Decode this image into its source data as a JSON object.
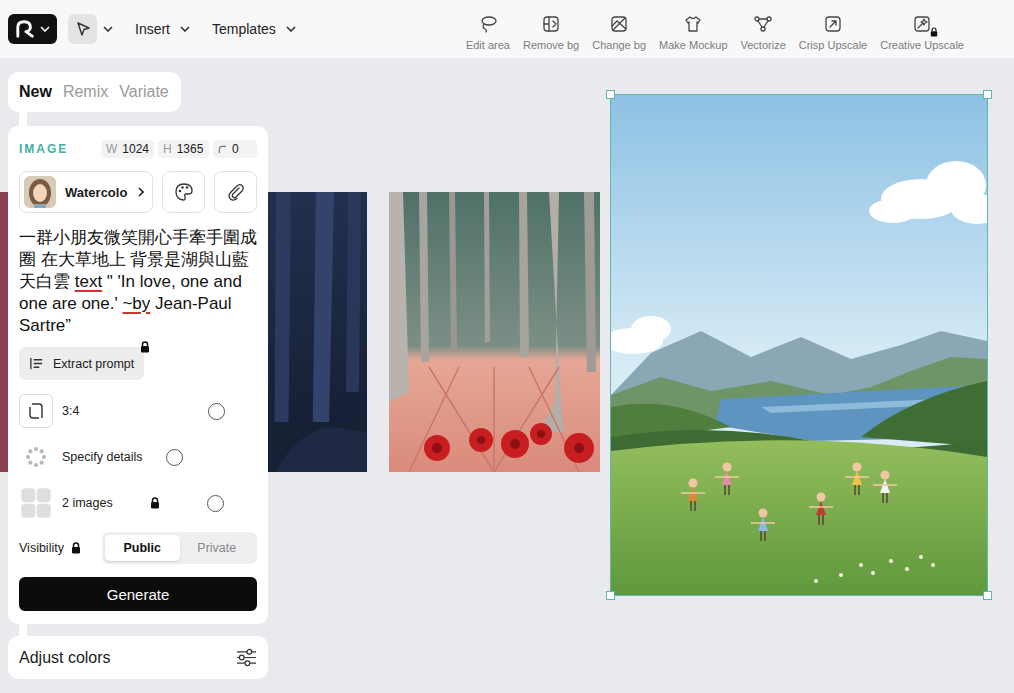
{
  "menus": [
    {
      "label": "Insert"
    },
    {
      "label": "Templates"
    }
  ],
  "tools": [
    {
      "label": "Edit area",
      "locked": false
    },
    {
      "label": "Remove bg",
      "locked": false
    },
    {
      "label": "Change bg",
      "locked": false
    },
    {
      "label": "Make Mockup",
      "locked": false
    },
    {
      "label": "Vectorize",
      "locked": false
    },
    {
      "label": "Crisp Upscale",
      "locked": false
    },
    {
      "label": "Creative Upscale",
      "locked": true
    }
  ],
  "mode_tabs": [
    {
      "label": "New",
      "selected": true
    },
    {
      "label": "Remix",
      "selected": false
    },
    {
      "label": "Variate",
      "selected": false
    }
  ],
  "image_settings": {
    "title": "IMAGE",
    "fields": [
      {
        "kind": "dim",
        "label": "W",
        "value": "1024"
      },
      {
        "kind": "dim",
        "label": "H",
        "value": "1365"
      },
      {
        "kind": "radius",
        "label": "",
        "value": "0"
      }
    ]
  },
  "style": {
    "name": "Watercolo"
  },
  "prompt": {
    "segments": [
      {
        "text": "一群小朋友微笑開心手牽手圍成圈 在大草地上 背景是湖與山藍天白雲 ",
        "misspelled": false
      },
      {
        "text": "text",
        "misspelled": true
      },
      {
        "text": " \" 'In love, one and one are one.' ",
        "misspelled": false
      },
      {
        "text": "~by",
        "misspelled": true
      },
      {
        "text": " Jean-Paul Sartre”",
        "misspelled": false
      }
    ]
  },
  "extract_prompt": {
    "label": "Extract prompt",
    "locked": true
  },
  "options": [
    {
      "kind": "aspect",
      "label": "3:4",
      "locked": false,
      "checked": false
    },
    {
      "kind": "details",
      "label": "Specify details",
      "locked": false,
      "checked": false
    },
    {
      "kind": "count",
      "label": "2 images",
      "locked": true,
      "checked": false
    }
  ],
  "visibility": {
    "label": "Visibility",
    "locked": true,
    "choices": [
      {
        "label": "Public",
        "selected": true
      },
      {
        "label": "Private",
        "selected": false
      }
    ]
  },
  "generate": {
    "label": "Generate"
  },
  "adjust_colors": {
    "label": "Adjust colors"
  },
  "canvas": {
    "images": [
      {
        "kind": "roses",
        "selected": false
      },
      {
        "kind": "night-forest",
        "selected": false
      },
      {
        "kind": "pink-forest",
        "selected": false
      },
      {
        "kind": "lake-meadow",
        "selected": true
      }
    ]
  }
}
